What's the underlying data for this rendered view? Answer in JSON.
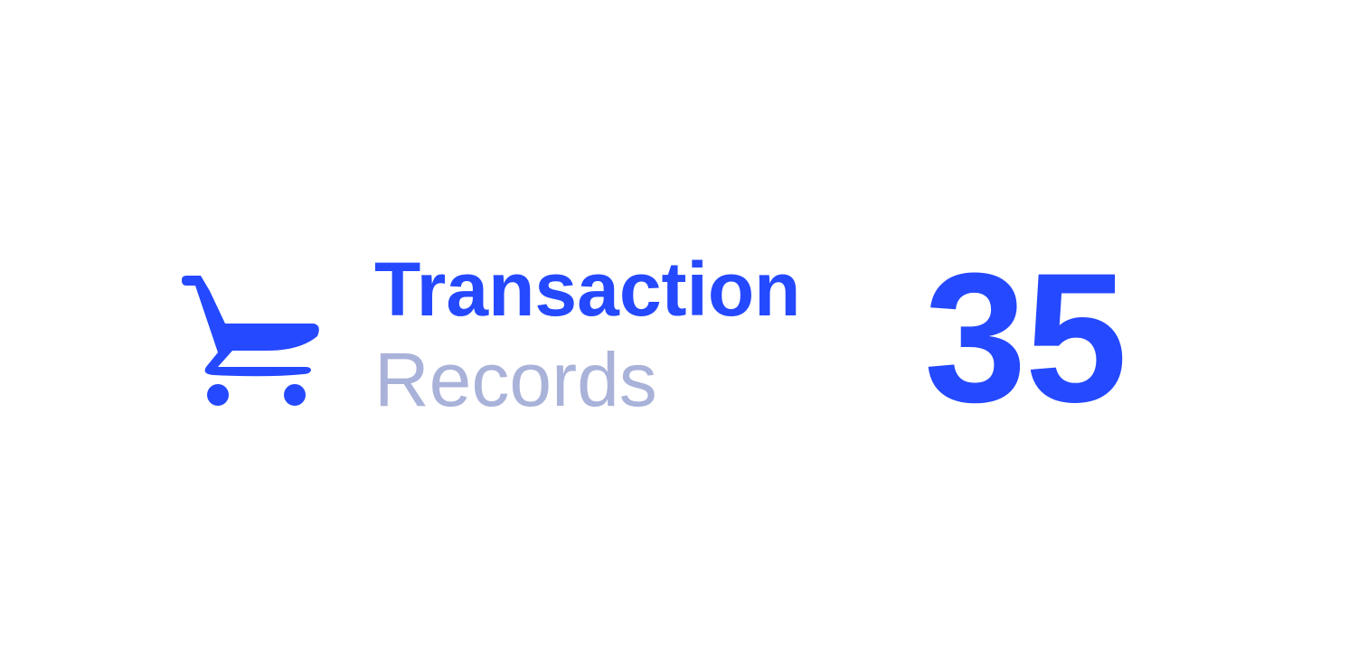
{
  "stat_card": {
    "icon": "shopping-cart-icon",
    "title": "Transaction",
    "subtitle": "Records",
    "value": "35"
  },
  "colors": {
    "accent": "#2549ff",
    "muted": "#a9b2d9",
    "background": "#ffffff"
  }
}
